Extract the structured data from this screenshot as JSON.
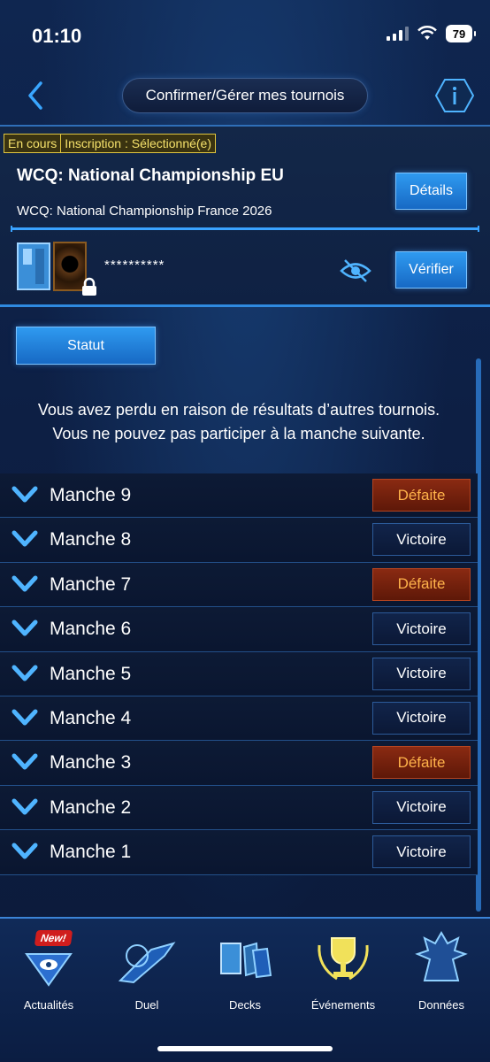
{
  "status_bar": {
    "time": "01:10",
    "battery": "79"
  },
  "header": {
    "title": "Confirmer/Gérer mes tournois",
    "back_icon": "chevron-left-icon",
    "info_icon": "info-icon"
  },
  "tournament": {
    "tag_status": "En cours",
    "tag_registration": "Inscription : Sélectionné(e)",
    "name": "WCQ: National Championship EU",
    "subname": "WCQ: National Championship France 2026",
    "details_label": "Détails",
    "deck_password": "**********",
    "verify_label": "Vérifier"
  },
  "statut_label": "Statut",
  "message": {
    "line1": "Vous avez perdu en raison de résultats d’autres tournois.",
    "line2": "Vous ne pouvez pas participer à la manche suivante."
  },
  "rounds": [
    {
      "label": "Manche 9",
      "result": "Défaite",
      "type": "loss"
    },
    {
      "label": "Manche 8",
      "result": "Victoire",
      "type": "win"
    },
    {
      "label": "Manche 7",
      "result": "Défaite",
      "type": "loss"
    },
    {
      "label": "Manche 6",
      "result": "Victoire",
      "type": "win"
    },
    {
      "label": "Manche 5",
      "result": "Victoire",
      "type": "win"
    },
    {
      "label": "Manche 4",
      "result": "Victoire",
      "type": "win"
    },
    {
      "label": "Manche 3",
      "result": "Défaite",
      "type": "loss"
    },
    {
      "label": "Manche 2",
      "result": "Victoire",
      "type": "win"
    },
    {
      "label": "Manche 1",
      "result": "Victoire",
      "type": "win"
    }
  ],
  "nav": {
    "news": {
      "label": "Actualités",
      "badge": "New!"
    },
    "duel": {
      "label": "Duel"
    },
    "decks": {
      "label": "Decks"
    },
    "events": {
      "label": "Événements"
    },
    "data": {
      "label": "Données"
    }
  },
  "colors": {
    "accent": "#2f9af0",
    "loss": "#8a2a12",
    "loss_text": "#ffb24a",
    "tag": "#e0c640"
  }
}
